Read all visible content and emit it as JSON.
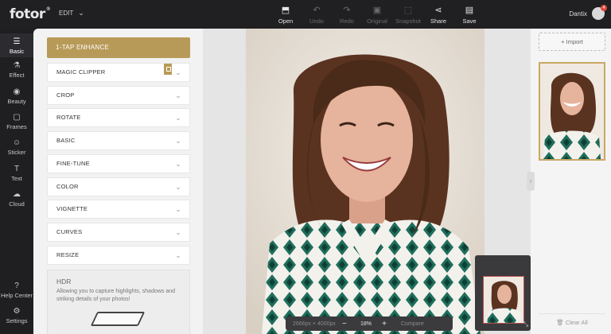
{
  "app": {
    "logo": "fotor",
    "edit_label": "EDIT"
  },
  "toolbar": [
    {
      "label": "Open",
      "icon": "open-icon",
      "disabled": false
    },
    {
      "label": "Undo",
      "icon": "undo-icon",
      "disabled": true
    },
    {
      "label": "Redo",
      "icon": "redo-icon",
      "disabled": true
    },
    {
      "label": "Original",
      "icon": "original-icon",
      "disabled": true
    },
    {
      "label": "Snapshot",
      "icon": "snapshot-icon",
      "disabled": true
    },
    {
      "label": "Share",
      "icon": "share-icon",
      "disabled": false
    },
    {
      "label": "Save",
      "icon": "save-icon",
      "disabled": false
    }
  ],
  "user": {
    "name": "Dantix",
    "notifications": "4"
  },
  "leftnav": [
    {
      "label": "Basic",
      "icon": "sliders-icon",
      "active": true
    },
    {
      "label": "Effect",
      "icon": "flask-icon",
      "active": false
    },
    {
      "label": "Beauty",
      "icon": "eye-icon",
      "active": false
    },
    {
      "label": "Frames",
      "icon": "frame-icon",
      "active": false
    },
    {
      "label": "Sticker",
      "icon": "sticker-icon",
      "active": false
    },
    {
      "label": "Text",
      "icon": "text-icon",
      "active": false
    },
    {
      "label": "Cloud",
      "icon": "cloud-icon",
      "active": false
    },
    {
      "label": "Help Center",
      "icon": "help-icon",
      "active": false
    },
    {
      "label": "Settings",
      "icon": "settings-icon",
      "active": false
    }
  ],
  "panel": {
    "enhance_label": "1-TAP ENHANCE",
    "tools": [
      "MAGIC CLIPPER",
      "CROP",
      "ROTATE",
      "BASIC",
      "FINE-TUNE",
      "COLOR",
      "VIGNETTE",
      "CURVES",
      "RESIZE"
    ],
    "hdr_title": "HDR",
    "hdr_desc": "Allowing you to capture highlights, shadows and striking details of your photos!"
  },
  "zoombar": {
    "dimensions": "2666px × 4000px",
    "zoom": "18%",
    "compare": "Compare"
  },
  "rightpanel": {
    "import_label": "Import",
    "clear_label": "Clear All"
  },
  "colors": {
    "accent": "#b89a58",
    "topbar": "#202023",
    "panel": "#f2f2f2"
  }
}
